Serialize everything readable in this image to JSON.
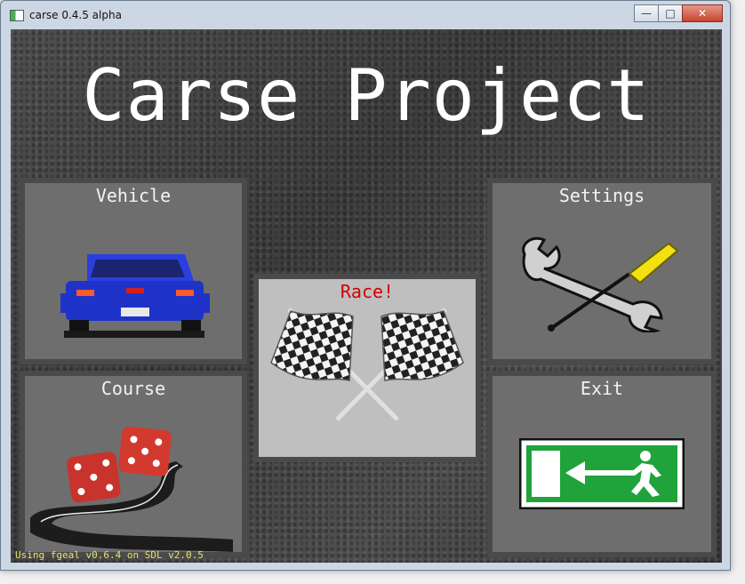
{
  "window": {
    "title": "carse 0.4.5 alpha"
  },
  "controls": {
    "minimize": "—",
    "maximize": "□",
    "close": "✕"
  },
  "game": {
    "title": "Carse Project"
  },
  "menu": {
    "vehicle": "Vehicle",
    "race": "Race!",
    "settings": "Settings",
    "course": "Course",
    "exit": "Exit"
  },
  "status": "Using fgeal v0.6.4 on SDL v2.0.5",
  "colors": {
    "race_label": "#d40000",
    "panel": "#6e6e6e",
    "race_panel": "#bfbfbf",
    "exit_sign": "#1fa33a",
    "car": "#1f33c9",
    "dice": "#c8332c",
    "status": "#e8e26a"
  },
  "icons": [
    "car-icon",
    "checkered-flags-icon",
    "wrench-screwdriver-icon",
    "dice-road-icon",
    "exit-sign-icon"
  ]
}
